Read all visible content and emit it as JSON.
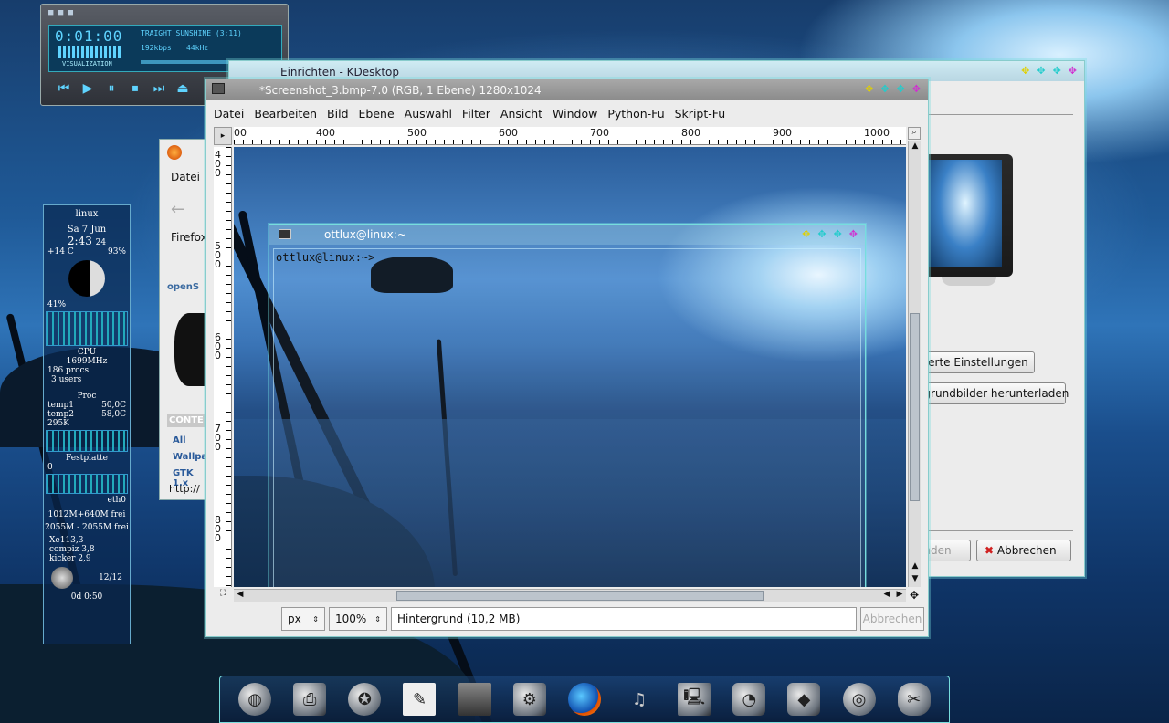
{
  "amarok": {
    "time": "0:01:00",
    "track": "TRAIGHT SUNSHINE (3:11)",
    "bitrate": "192kbps",
    "samplerate": "44kHz",
    "mode": "VISUALIZATION",
    "controls": [
      "prev-icon",
      "play-icon",
      "pause-icon",
      "stop-icon",
      "next-icon",
      "eject-icon"
    ]
  },
  "karamba": {
    "host": "linux",
    "date": "Sa 7 Jun",
    "clock": "2:43",
    "seconds": "24",
    "temp": "+14 C",
    "humidity": "93%",
    "cpu_load": "41%",
    "cpu_label": "CPU",
    "cpu_freq": "1699MHz",
    "procs": "186 procs.",
    "users": "3 users",
    "proc_label": "Proc",
    "temp1_label": "temp1",
    "temp1": "50,0C",
    "temp2_label": "temp2",
    "temp2": "58,0C",
    "net": "295K",
    "disk_label": "Festplatte",
    "disk_zero": "0",
    "eth": "eth0",
    "mem": "1012M+640M frei",
    "swap": "2055M - 2055M frei",
    "x11": "Xe113,3",
    "compiz": "compiz 3,8",
    "kicker": "kicker 2,9",
    "mail": "12/12",
    "uptime": "0d 0:50"
  },
  "kdesktop": {
    "title": "Einrichten - KDesktop",
    "advanced_btn": "...terte Einstellungen",
    "download_btn": "...grundbilder herunterladen",
    "apply_btn": "...nden",
    "cancel_btn": "Abbrechen"
  },
  "firefox": {
    "menu_first": "Datei",
    "toolbar_label": "Firefox",
    "status": "http://",
    "opensuse": "openS",
    "content_heading": "CONTE",
    "links": [
      "All",
      "Wallpap",
      "GTK 1.x"
    ]
  },
  "gimp": {
    "title": "*Screenshot_3.bmp-7.0 (RGB, 1 Ebene) 1280x1024",
    "menu": [
      "Datei",
      "Bearbeiten",
      "Bild",
      "Ebene",
      "Auswahl",
      "Filter",
      "Ansicht",
      "Window",
      "Python-Fu",
      "Skript-Fu"
    ],
    "ruler_h": [
      "00",
      "400",
      "500",
      "600",
      "700",
      "800",
      "900",
      "1000"
    ],
    "ruler_v": [
      "4 0 0",
      "5 0 0",
      "6 0 0",
      "7 0 0",
      "8 0 0"
    ],
    "unit": "px",
    "zoom": "100%",
    "layer_status": "Hintergrund (10,2 MB)",
    "cancel_label": "Abbrechen"
  },
  "konsole": {
    "title": "ottlux@linux:~",
    "prompt": "ottlux@linux:~>"
  },
  "dock": {
    "icons": [
      "globe-icon",
      "printer-icon",
      "kde-icon",
      "text-editor-icon",
      "terminal-icon",
      "settings-icon",
      "firefox-icon",
      "music-icon",
      "computer-icon",
      "app-icon-1",
      "app-icon-2",
      "disk-icon",
      "gimp-icon"
    ]
  }
}
